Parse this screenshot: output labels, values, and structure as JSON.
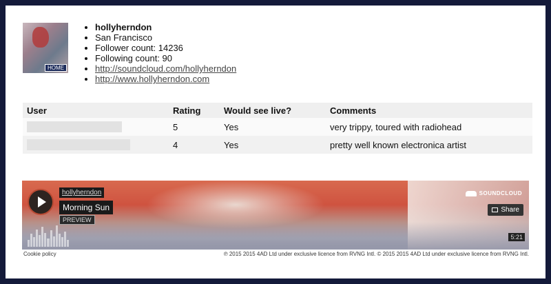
{
  "profile": {
    "username": "hollyherndon",
    "city": "San Francisco",
    "follower_count": "Follower count: 14236",
    "following_count": "Following count: 90",
    "links": [
      "http://soundcloud.com/hollyherndon",
      "http://www.hollyherndon.com"
    ],
    "avatar_badge": "HOME"
  },
  "table": {
    "headers": [
      "User",
      "Rating",
      "Would see live?",
      "Comments"
    ],
    "rows": [
      {
        "user": "",
        "rating": "5",
        "live": "Yes",
        "comment": "very trippy, toured with radiohead"
      },
      {
        "user": "",
        "rating": "4",
        "live": "Yes",
        "comment": "pretty well known electronica artist"
      }
    ]
  },
  "player": {
    "artist": "hollyherndon",
    "track": "Morning Sun",
    "preview_label": "PREVIEW",
    "brand": "SOUNDCLOUD",
    "share_label": "Share",
    "duration": "5:21",
    "accent": "#b84a33"
  },
  "footer": {
    "cookie_policy": "Cookie policy",
    "copyright": "℗ 2015 2015 4AD Ltd under exclusive licence from RVNG Intl. © 2015 2015 4AD Ltd under exclusive licence from RVNG Intl."
  }
}
